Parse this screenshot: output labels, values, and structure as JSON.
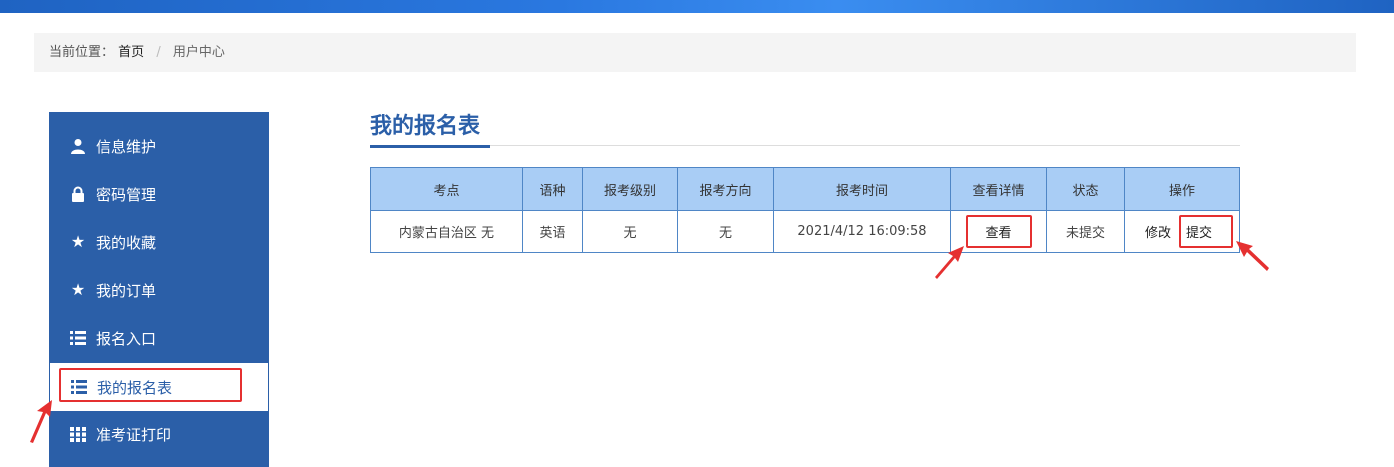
{
  "breadcrumb": {
    "prefix": "当前位置：",
    "home": "首页",
    "separator": "/",
    "current": "用户中心"
  },
  "sidebar": {
    "items": [
      {
        "label": "信息维护",
        "icon": "user-icon"
      },
      {
        "label": "密码管理",
        "icon": "lock-icon"
      },
      {
        "label": "我的收藏",
        "icon": "star-icon"
      },
      {
        "label": "我的订单",
        "icon": "star-icon"
      },
      {
        "label": "报名入口",
        "icon": "list-icon"
      },
      {
        "label": "我的报名表",
        "icon": "list-icon",
        "active": true
      },
      {
        "label": "准考证打印",
        "icon": "grid-icon"
      }
    ]
  },
  "main": {
    "title": "我的报名表",
    "table": {
      "headers": [
        "考点",
        "语种",
        "报考级别",
        "报考方向",
        "报考时间",
        "查看详情",
        "状态",
        "操作"
      ],
      "rows": [
        {
          "exam_site": "内蒙古自治区 无",
          "language": "英语",
          "level": "无",
          "direction": "无",
          "time": "2021/4/12 16:09:58",
          "view": "查看",
          "status": "未提交",
          "edit": "修改",
          "submit": "提交"
        }
      ]
    }
  },
  "colors": {
    "sidebar": "#2b5fa8",
    "header_cell": "#a9cdf5",
    "highlight": "#e53030"
  }
}
